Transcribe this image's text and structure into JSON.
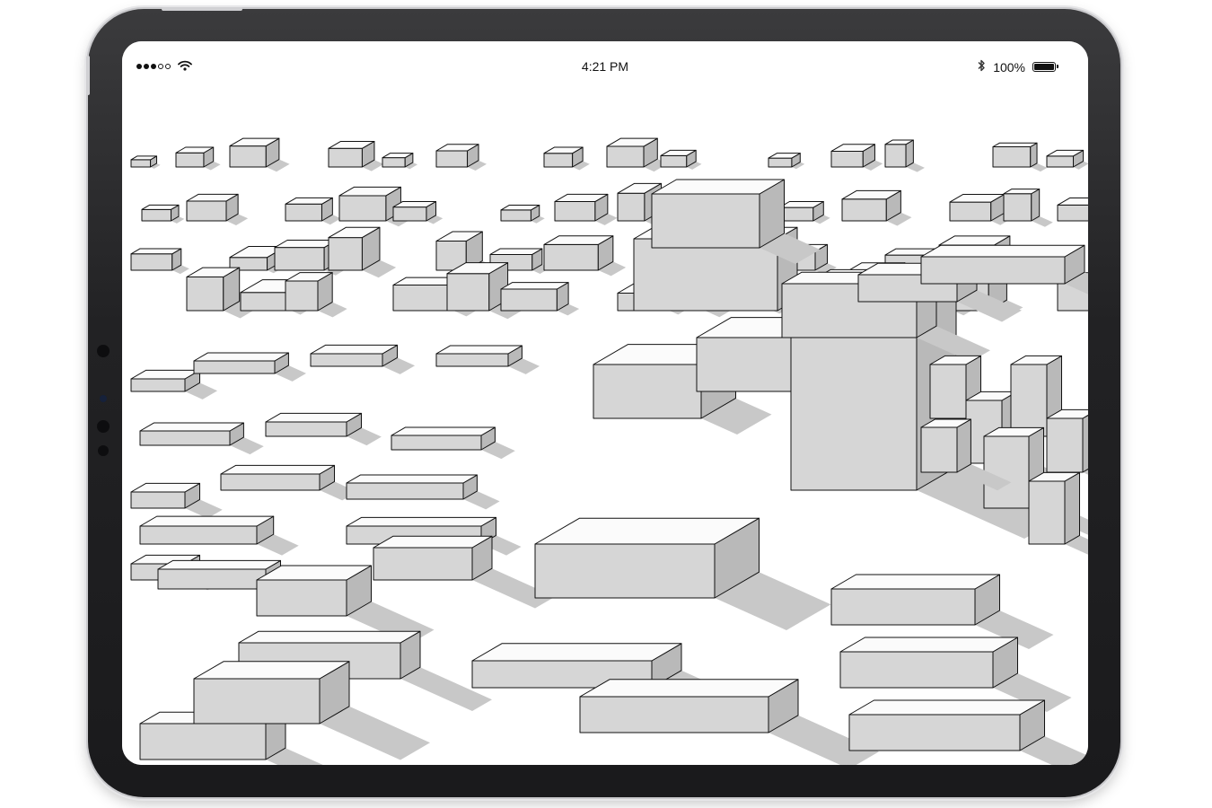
{
  "device": {
    "type": "tablet",
    "frame_color": "#222224"
  },
  "status_bar": {
    "signal_strength": 3,
    "signal_max": 5,
    "wifi": "wifi-icon",
    "time": "4:21 PM",
    "bluetooth": "bluetooth-icon",
    "battery_percent": "100%",
    "battery_level": 1.0
  },
  "viewport": {
    "content": "3d-model-view",
    "style": "sketch-shaded",
    "colors": {
      "top_face": "#fbfbfb",
      "side_face": "#d6d6d6",
      "dark_face": "#b9b9b9",
      "edge": "#111111",
      "shadow": "#c8c8c8",
      "background": "#ffffff"
    }
  }
}
